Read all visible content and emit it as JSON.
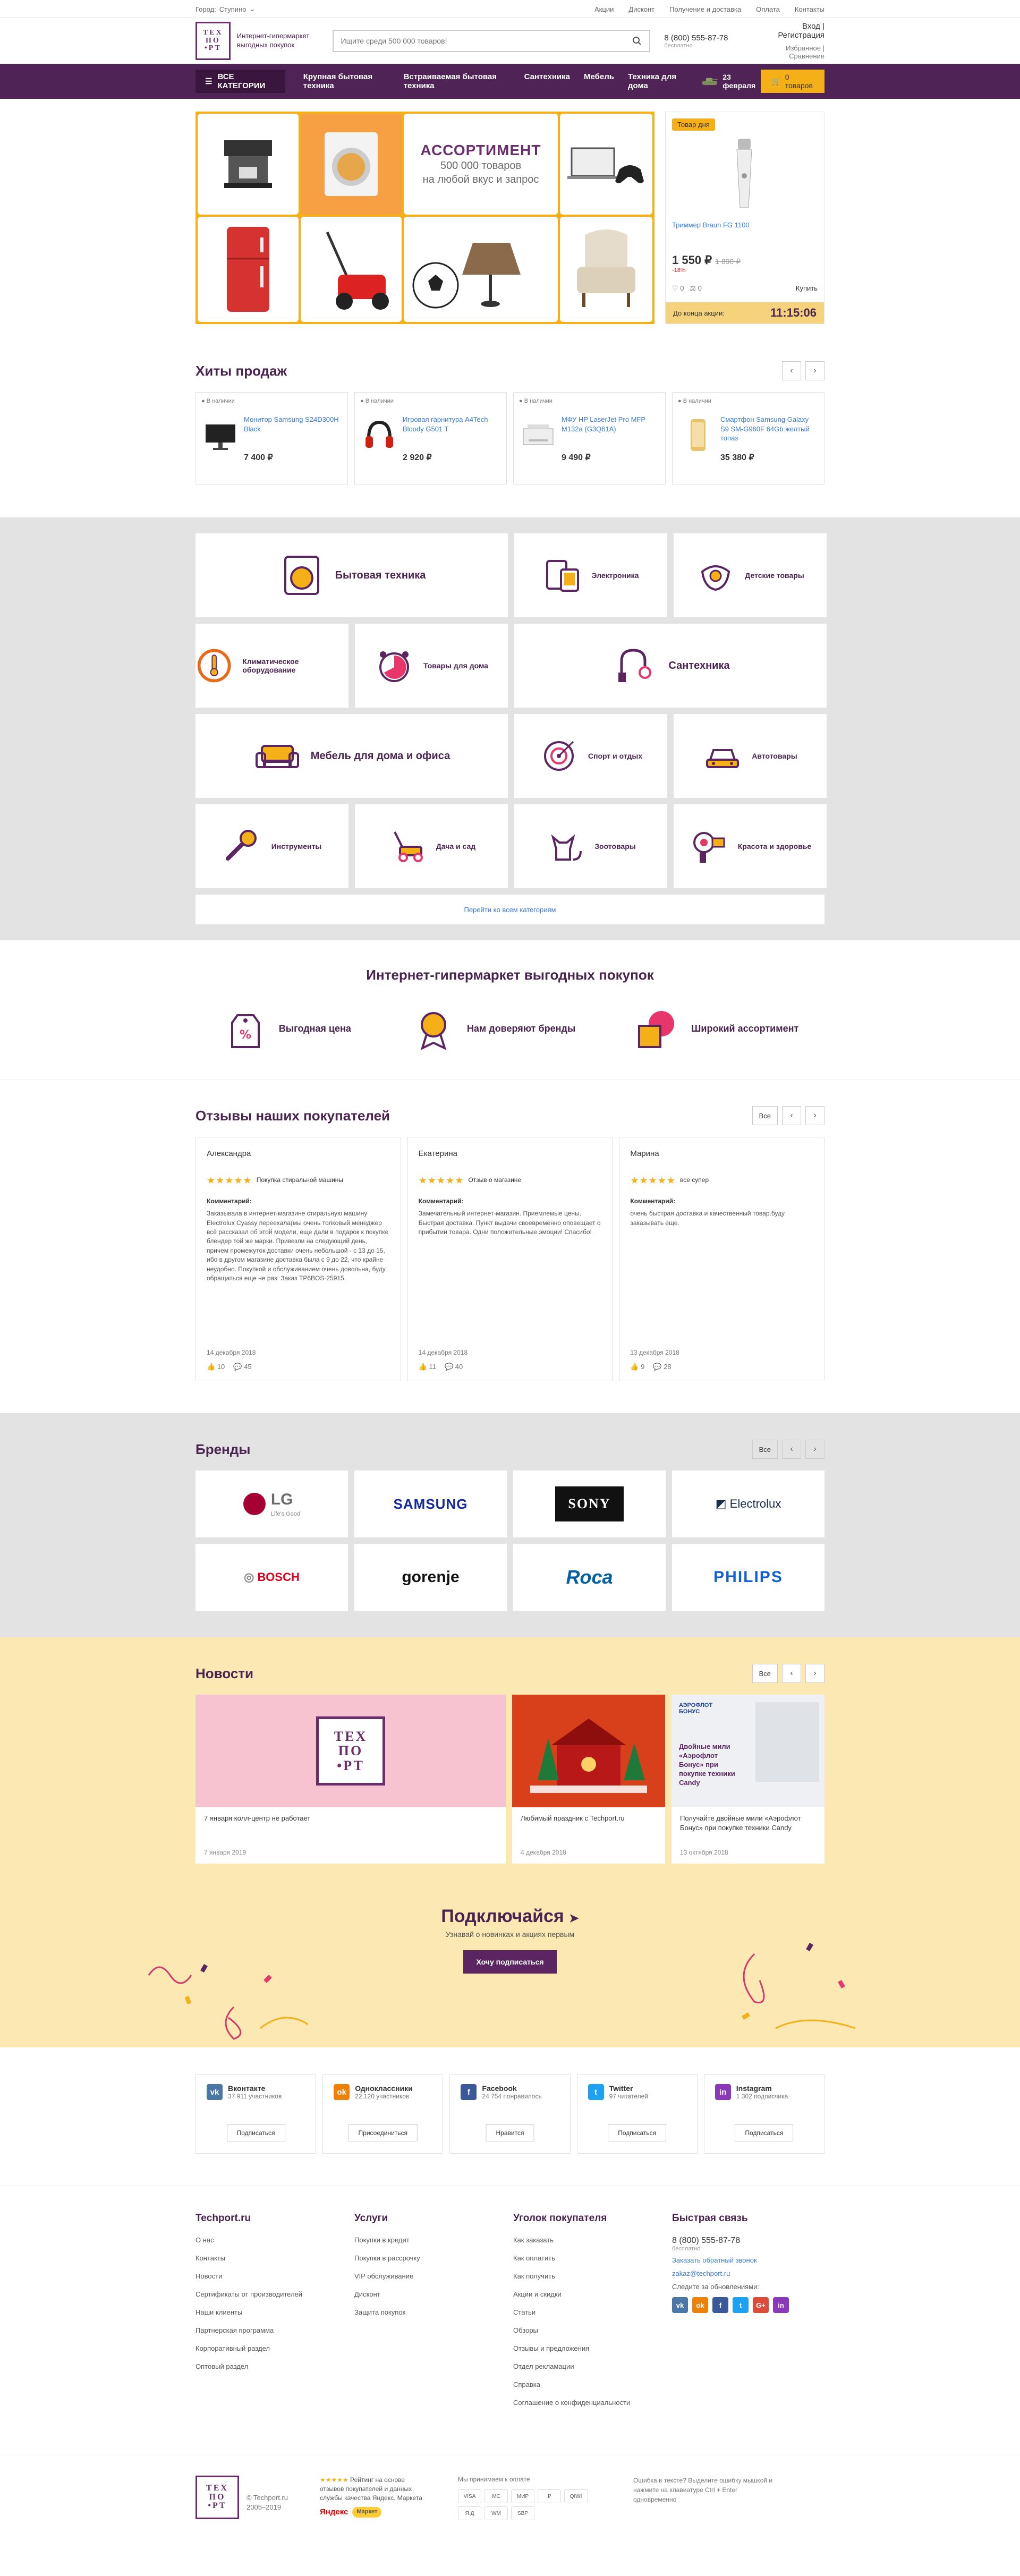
{
  "topbar": {
    "city_label": "Город:",
    "city": "Ступино",
    "links": [
      "Акции",
      "Дисконт",
      "Получение и доставка",
      "Оплата",
      "Контакты"
    ]
  },
  "header": {
    "logo_lines": [
      "ТЕХ",
      "ПО",
      "•РТ"
    ],
    "slogan": "Интернет-гипермаркет выгодных покупок",
    "search_placeholder": "Ищите среди 500 000 товаров!",
    "phone": "8 (800) 555-87-78",
    "phone_note": "бесплатно",
    "login": "Вход",
    "register": "Регистрация",
    "favorites": "Избранное",
    "compare": "Сравнение"
  },
  "nav": {
    "all_categories": "ВСЕ КАТЕГОРИИ",
    "items": [
      "Крупная бытовая техника",
      "Встраиваемая бытовая техника",
      "Сантехника",
      "Мебель",
      "Техника для дома"
    ],
    "promo": "23 февраля",
    "cart": "0 товаров"
  },
  "banner": {
    "heading": "АССОРТИМЕНТ",
    "line1": "500 000 товаров",
    "line2": "на любой вкус и запрос"
  },
  "deal": {
    "badge": "Товар дня",
    "name": "Триммер Braun FG 1100",
    "price": "1 550 ₽",
    "old_price": "1 890 ₽",
    "discount": "-18%",
    "favs": "0",
    "comps": "0",
    "buy": "Купить",
    "timer_label": "До конца акции:",
    "timer": "11:15:06"
  },
  "hits": {
    "title": "Хиты продаж",
    "items": [
      {
        "stock": "● В наличии",
        "name": "Монитор Samsung S24D300H Black",
        "price": "7 400 ₽"
      },
      {
        "stock": "● В наличии",
        "name": "Игровая гарнитура A4Tech Bloody G501 T",
        "price": "2 920 ₽"
      },
      {
        "stock": "● В наличии",
        "name": "МФУ HP LaserJet Pro MFP M132a (G3Q61A)",
        "price": "9 490 ₽"
      },
      {
        "stock": "● В наличии",
        "name": "Смартфон Samsung Galaxy S9 SM-G960F 64Gb желтый топаз",
        "price": "35 380 ₽"
      }
    ]
  },
  "categories": {
    "items": [
      {
        "name": "Бытовая техника",
        "icon": "washer-icon"
      },
      {
        "name": "Электроника",
        "icon": "devices-icon"
      },
      {
        "name": "Детские товары",
        "icon": "pacifier-icon"
      },
      {
        "name": "Климатическое оборудование",
        "icon": "thermometer-icon"
      },
      {
        "name": "Товары для дома",
        "icon": "clock-icon"
      },
      {
        "name": "Сантехника",
        "icon": "faucet-icon"
      },
      {
        "name": "Мебель для дома и офиса",
        "icon": "sofa-icon"
      },
      {
        "name": "Спорт и отдых",
        "icon": "target-icon"
      },
      {
        "name": "Автотовары",
        "icon": "car-icon"
      },
      {
        "name": "Инструменты",
        "icon": "wrench-icon"
      },
      {
        "name": "Дача и сад",
        "icon": "mower-icon"
      },
      {
        "name": "Зоотовары",
        "icon": "cat-icon"
      },
      {
        "name": "Красота и здоровье",
        "icon": "hairdryer-icon"
      }
    ],
    "all_link": "Перейти ко всем категориям"
  },
  "benefits": {
    "title": "Интернет-гипермаркет выгодных покупок",
    "items": [
      "Выгодная цена",
      "Нам доверяют бренды",
      "Широкий ассортимент"
    ]
  },
  "reviews": {
    "title": "Отзывы наших покупателей",
    "all": "Все",
    "comment_label": "Комментарий:",
    "items": [
      {
        "author": "Александра",
        "topic": "Покупка стиральной машины",
        "text": "Заказывала в интернет-магазине стиральную машину Electrolux Cyassy переехала(мы очень толковый менеджер всё рассказал об этой модели, еще дали в подарок к покупке блендер той же марки. Привезли на следующий день, причем промежуток доставки очень небольшой - с 13 до 15, ибо в другом магазине доставка была с 9 до 22, что крайне неудобно. Покупкой и обслуживанием очень довольна, буду обращаться еще не раз. Заказ TP6BOS-25915.",
        "date": "14 декабря 2018",
        "likes": "10",
        "comments": "45"
      },
      {
        "author": "Екатерина",
        "topic": "Отзыв о магазине",
        "text": "Замечательный интернет-магазин. Приемлемые цены. Быстрая доставка. Пункт выдачи своевременно оповещает о прибытии товара. Одни положительные эмоции! Спасибо!",
        "date": "14 декабря 2018",
        "likes": "11",
        "comments": "40"
      },
      {
        "author": "Марина",
        "topic": "все супер",
        "text": "очень быстрая доставка и качественный товар.буду заказывать еще.",
        "date": "13 декабря 2018",
        "likes": "9",
        "comments": "28"
      }
    ]
  },
  "brands": {
    "title": "Бренды",
    "all": "Все",
    "items": [
      "LG",
      "SAMSUNG",
      "SONY",
      "Electrolux",
      "BOSCH",
      "gorenje",
      "Roca",
      "PHILIPS"
    ],
    "lg_tagline": "Life's Good"
  },
  "news": {
    "title": "Новости",
    "all": "Все",
    "items": [
      {
        "title": "7 января колл-центр не работает",
        "date": "7 января 2019"
      },
      {
        "title": "Любимый праздник с Techport.ru",
        "date": "4 декабря 2018"
      },
      {
        "title": "Получайте двойные мили «Аэрофлот Бонус» при покупке техники Candy",
        "date": "13 октября 2018"
      }
    ],
    "aeroflot_logo": "АЭРОФЛОТ БОНУС",
    "aeroflot_text": "Двойные мили «Аэрофлот Бонус» при покупке техники Candy"
  },
  "subscribe": {
    "title": "Подключайся",
    "text": "Узнавай о новинках и акциях первым",
    "button": "Хочу подписаться"
  },
  "social": {
    "items": [
      {
        "name": "Вконтакте",
        "count": "37 911 участников",
        "button": "Подписаться",
        "color": "#4a76a8",
        "glyph": "vk"
      },
      {
        "name": "Одноклассники",
        "count": "22 120 участников",
        "button": "Присоединиться",
        "color": "#ee8208",
        "glyph": "ok"
      },
      {
        "name": "Facebook",
        "count": "24 754 понравилось",
        "button": "Нравится",
        "color": "#3b5998",
        "glyph": "f"
      },
      {
        "name": "Twitter",
        "count": "97 читателей",
        "button": "Подписаться",
        "color": "#1da1f2",
        "glyph": "t"
      },
      {
        "name": "Instagram",
        "count": "1 302 подписчика",
        "button": "Подписаться",
        "color": "#8a3ab9",
        "glyph": "in"
      }
    ]
  },
  "footer": {
    "col1": {
      "title": "Techport.ru",
      "links": [
        "О нас",
        "Контакты",
        "Новости",
        "Сертификаты от производителей",
        "Наши клиенты",
        "Партнерская программа",
        "Корпоративный раздел",
        "Оптовый раздел"
      ]
    },
    "col2": {
      "title": "Услуги",
      "links": [
        "Покупки в кредит",
        "Покупки в рассрочку",
        "VIP обслуживание",
        "Дисконт",
        "Защита покупок"
      ]
    },
    "col3": {
      "title": "Уголок покупателя",
      "links": [
        "Как заказать",
        "Как оплатить",
        "Как получить",
        "Акции и скидки",
        "Статьи",
        "Обзоры",
        "Отзывы и предложения",
        "Отдел рекламации",
        "Справка",
        "Соглашение о конфиденциальности"
      ]
    },
    "col4": {
      "title": "Быстрая связь",
      "phone": "8 (800) 555-87-78",
      "phone_note": "бесплатно",
      "callback": "Заказать обратный звонок",
      "email": "zakaz@techport.ru",
      "social_label": "Следите за обновлениями:"
    }
  },
  "bottom": {
    "copyright": "© Techport.ru",
    "years": "2005–2019",
    "rating_text": "Рейтинг на основе отзывов покупателей и данных службы качества Яндекс. Маркета",
    "yandex": "Яндекс",
    "market": "Маркет",
    "pay_label": "Мы принимаем к оплате",
    "pay_cards": [
      "VISA",
      "MC",
      "МИР",
      "₽",
      "QIWI",
      "Я.Д",
      "WM",
      "SBP"
    ],
    "error_text": "Ошибка в тексте? Выделите ошибку мышкой и нажмите на клавиатуре Ctrl + Enter одновременно"
  }
}
